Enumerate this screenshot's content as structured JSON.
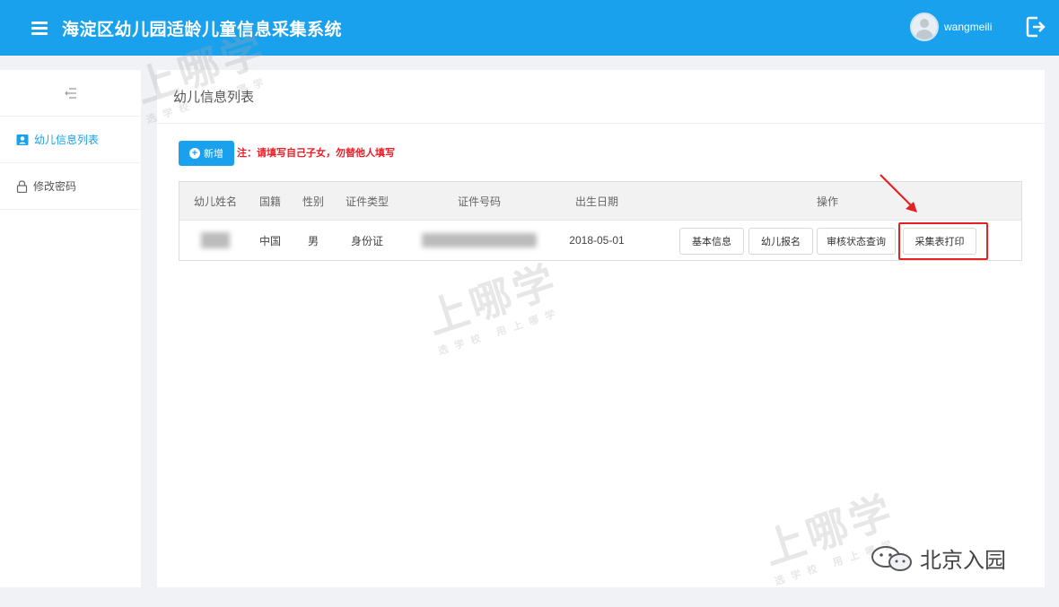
{
  "header": {
    "app_title": "海淀区幼儿园适龄儿童信息采集系统",
    "username": "wangmeili"
  },
  "sidebar": {
    "items": [
      {
        "label": "幼儿信息列表",
        "active": true,
        "icon": "user-card-icon"
      },
      {
        "label": "修改密码",
        "active": false,
        "icon": "lock-icon"
      }
    ]
  },
  "main": {
    "page_title": "幼儿信息列表",
    "add_button": "新增",
    "note": "注：请填写自己子女，勿替他人填写",
    "table": {
      "columns": [
        "幼儿姓名",
        "国籍",
        "性别",
        "证件类型",
        "证件号码",
        "出生日期",
        "操作"
      ],
      "rows": [
        {
          "nationality": "中国",
          "gender": "男",
          "id_type": "身份证",
          "birth_date": "2018-05-01",
          "actions": [
            "基本信息",
            "幼儿报名",
            "审核状态查询",
            "采集表打印"
          ]
        }
      ]
    }
  },
  "watermark": {
    "main": "上哪学",
    "sub": "选学校 用上哪学"
  },
  "footer_logo": "北京入园",
  "colors": {
    "primary": "#1aa1ee",
    "note_red": "#ee1c25",
    "highlight_red": "#e52222"
  }
}
